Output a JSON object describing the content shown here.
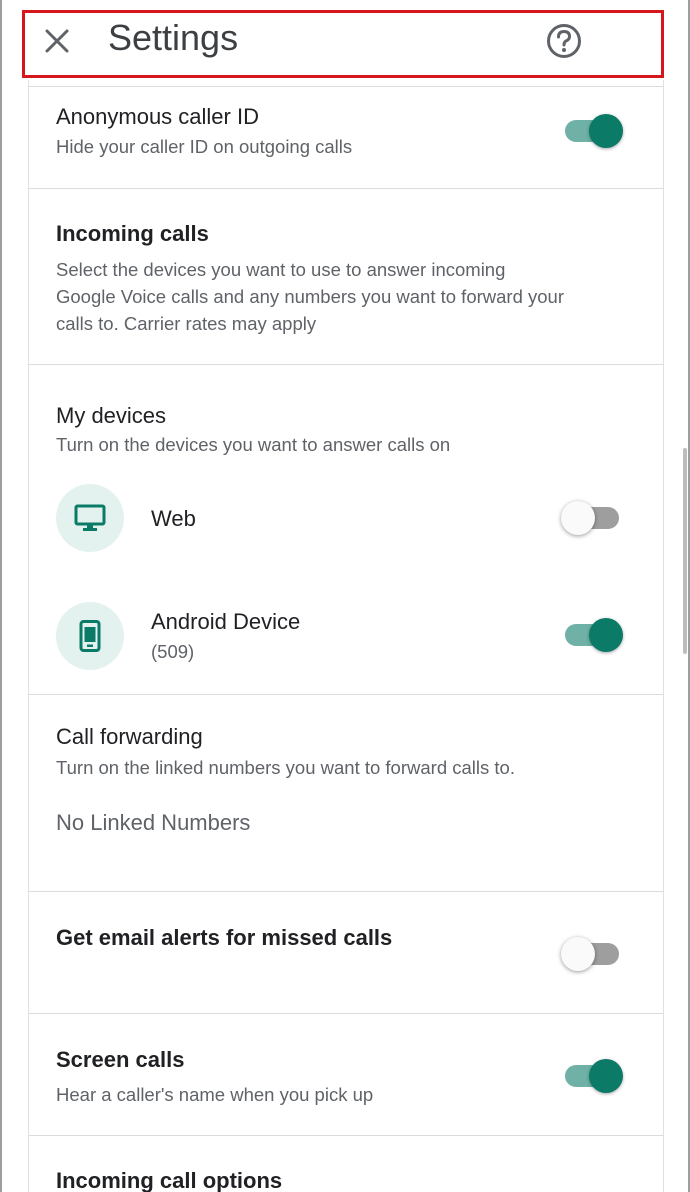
{
  "header": {
    "title": "Settings"
  },
  "anonymous_caller_id": {
    "title": "Anonymous caller ID",
    "subtitle": "Hide your caller ID on outgoing calls",
    "enabled": true
  },
  "incoming_calls": {
    "title": "Incoming calls",
    "description_lines": [
      "Select the devices you want to use to answer incoming",
      "Google Voice calls and any numbers you want to forward your",
      "calls to. Carrier rates may apply"
    ]
  },
  "my_devices": {
    "title": "My devices",
    "subtitle": "Turn on the devices you want to answer calls on",
    "devices": [
      {
        "name": "Web",
        "detail": "",
        "icon": "monitor-icon",
        "enabled": false
      },
      {
        "name": "Android Device",
        "detail": "(509)",
        "icon": "phone-icon",
        "enabled": true
      }
    ]
  },
  "call_forwarding": {
    "title": "Call forwarding",
    "subtitle": "Turn on the linked numbers you want to forward calls to.",
    "empty_text": "No Linked Numbers"
  },
  "email_alerts": {
    "title": "Get email alerts for missed calls",
    "enabled": false
  },
  "screen_calls": {
    "title": "Screen calls",
    "subtitle": "Hear a caller's name when you pick up",
    "enabled": true
  },
  "incoming_call_options": {
    "title": "Incoming call options"
  },
  "colors": {
    "accent": "#0b7a66",
    "accent_track": "#6fb1a6",
    "highlight_border": "#d5171d",
    "icon_bg": "#e3f2ef"
  }
}
